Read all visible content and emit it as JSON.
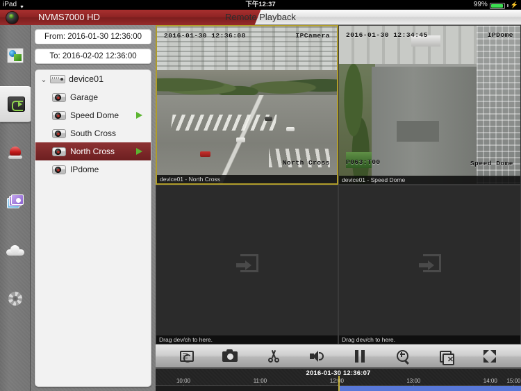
{
  "status_bar": {
    "carrier": "iPad",
    "wifi_icon": "wifi-icon",
    "time": "下午12:37",
    "battery_percent": "99%",
    "battery_icon": "battery-icon",
    "charging_icon": "charging-plug-icon"
  },
  "title_bar": {
    "app_name": "NVMS7000 HD",
    "logo_icon": "app-logo-icon",
    "page_title": "Remote Playback"
  },
  "rail": {
    "items": [
      {
        "icon": "live-view-icon",
        "name": "rail-item-live-view",
        "active": false
      },
      {
        "icon": "playback-icon",
        "name": "rail-item-playback",
        "active": true
      },
      {
        "icon": "alarm-icon",
        "name": "rail-item-alarm",
        "active": false
      },
      {
        "icon": "picture-video-icon",
        "name": "rail-item-picture-video",
        "active": false
      },
      {
        "icon": "cloud-icon",
        "name": "rail-item-cloud",
        "active": false
      },
      {
        "icon": "gear-icon",
        "name": "rail-item-configuration",
        "active": false
      }
    ]
  },
  "left_panel": {
    "from_field": {
      "value": "From: 2016-01-30 12:36:00",
      "placeholder": "From:"
    },
    "to_field": {
      "value": "To: 2016-02-02 12:36:00",
      "placeholder": "To:"
    },
    "tree": {
      "root": {
        "label": "device01",
        "icon": "nvr-icon",
        "chevron": "chevron-down-icon",
        "expanded": true
      },
      "children": [
        {
          "label": "Garage",
          "playing": false
        },
        {
          "label": "Speed Dome",
          "playing": true
        },
        {
          "label": "South Cross",
          "playing": false
        },
        {
          "label": "North Cross",
          "playing": true,
          "selected": true
        },
        {
          "label": "IPdome",
          "playing": false
        }
      ]
    }
  },
  "video_cells": [
    {
      "name": "video-cell-north-cross",
      "selected": true,
      "osd_timestamp": "2016-01-30 12:36:08",
      "osd_camera_name": "IPCamera",
      "osd_overlay": "North Cross",
      "bar_label": "device01 - North Cross",
      "empty": false
    },
    {
      "name": "video-cell-speed-dome",
      "selected": false,
      "osd_timestamp": "2016-01-30 12:34:45",
      "osd_camera_name": "IPDome",
      "osd_overlay": "Speed Dome",
      "osd_ptz": "P063:T00",
      "bar_label": "device01 - Speed Dome",
      "empty": false
    },
    {
      "name": "video-cell-empty-3",
      "selected": false,
      "empty": true,
      "bar_label": "Drag dev/ch to here.",
      "drop_icon": "drop-target-icon"
    },
    {
      "name": "video-cell-empty-4",
      "selected": false,
      "empty": true,
      "bar_label": "Drag dev/ch to here.",
      "drop_icon": "drop-target-icon"
    }
  ],
  "toolbar": {
    "buttons": [
      {
        "name": "record-button",
        "icon": "record-file-icon",
        "label": "Record"
      },
      {
        "name": "capture-button",
        "icon": "camera-icon",
        "label": "Capture"
      },
      {
        "name": "clip-button",
        "icon": "scissors-icon",
        "label": "Clip"
      },
      {
        "name": "audio-button",
        "icon": "speaker-icon",
        "label": "Audio"
      },
      {
        "name": "pause-button",
        "icon": "pause-icon",
        "label": "Pause"
      },
      {
        "name": "digital-zoom-button",
        "icon": "zoom-in-icon",
        "label": "Digital Zoom"
      },
      {
        "name": "close-all-button",
        "icon": "close-all-icon",
        "label": "Stop All"
      },
      {
        "name": "fullscreen-button",
        "icon": "fullscreen-icon",
        "label": "Full Screen"
      }
    ]
  },
  "timeline": {
    "current_datetime": "2016-01-30 12:36:07",
    "ticks": [
      "10:00",
      "11:00",
      "12:00",
      "13:00",
      "14:00",
      "15:00"
    ],
    "tick_positions_pct": [
      7.6,
      28.6,
      49.6,
      70.6,
      91.6,
      112.6
    ],
    "playhead_pct": 50.0,
    "recording_segments": [
      {
        "start_pct": 50.0,
        "end_pct": 100.0,
        "color": "#5878d8"
      }
    ],
    "colors": {
      "recording": "#5878d8",
      "playhead": "#c8b43c"
    }
  },
  "colors": {
    "brand_red": "#8d2323",
    "selection_red": "#6d1f20",
    "selected_cell_border": "#b09d2a",
    "play_arrow_green": "#5cb531"
  }
}
